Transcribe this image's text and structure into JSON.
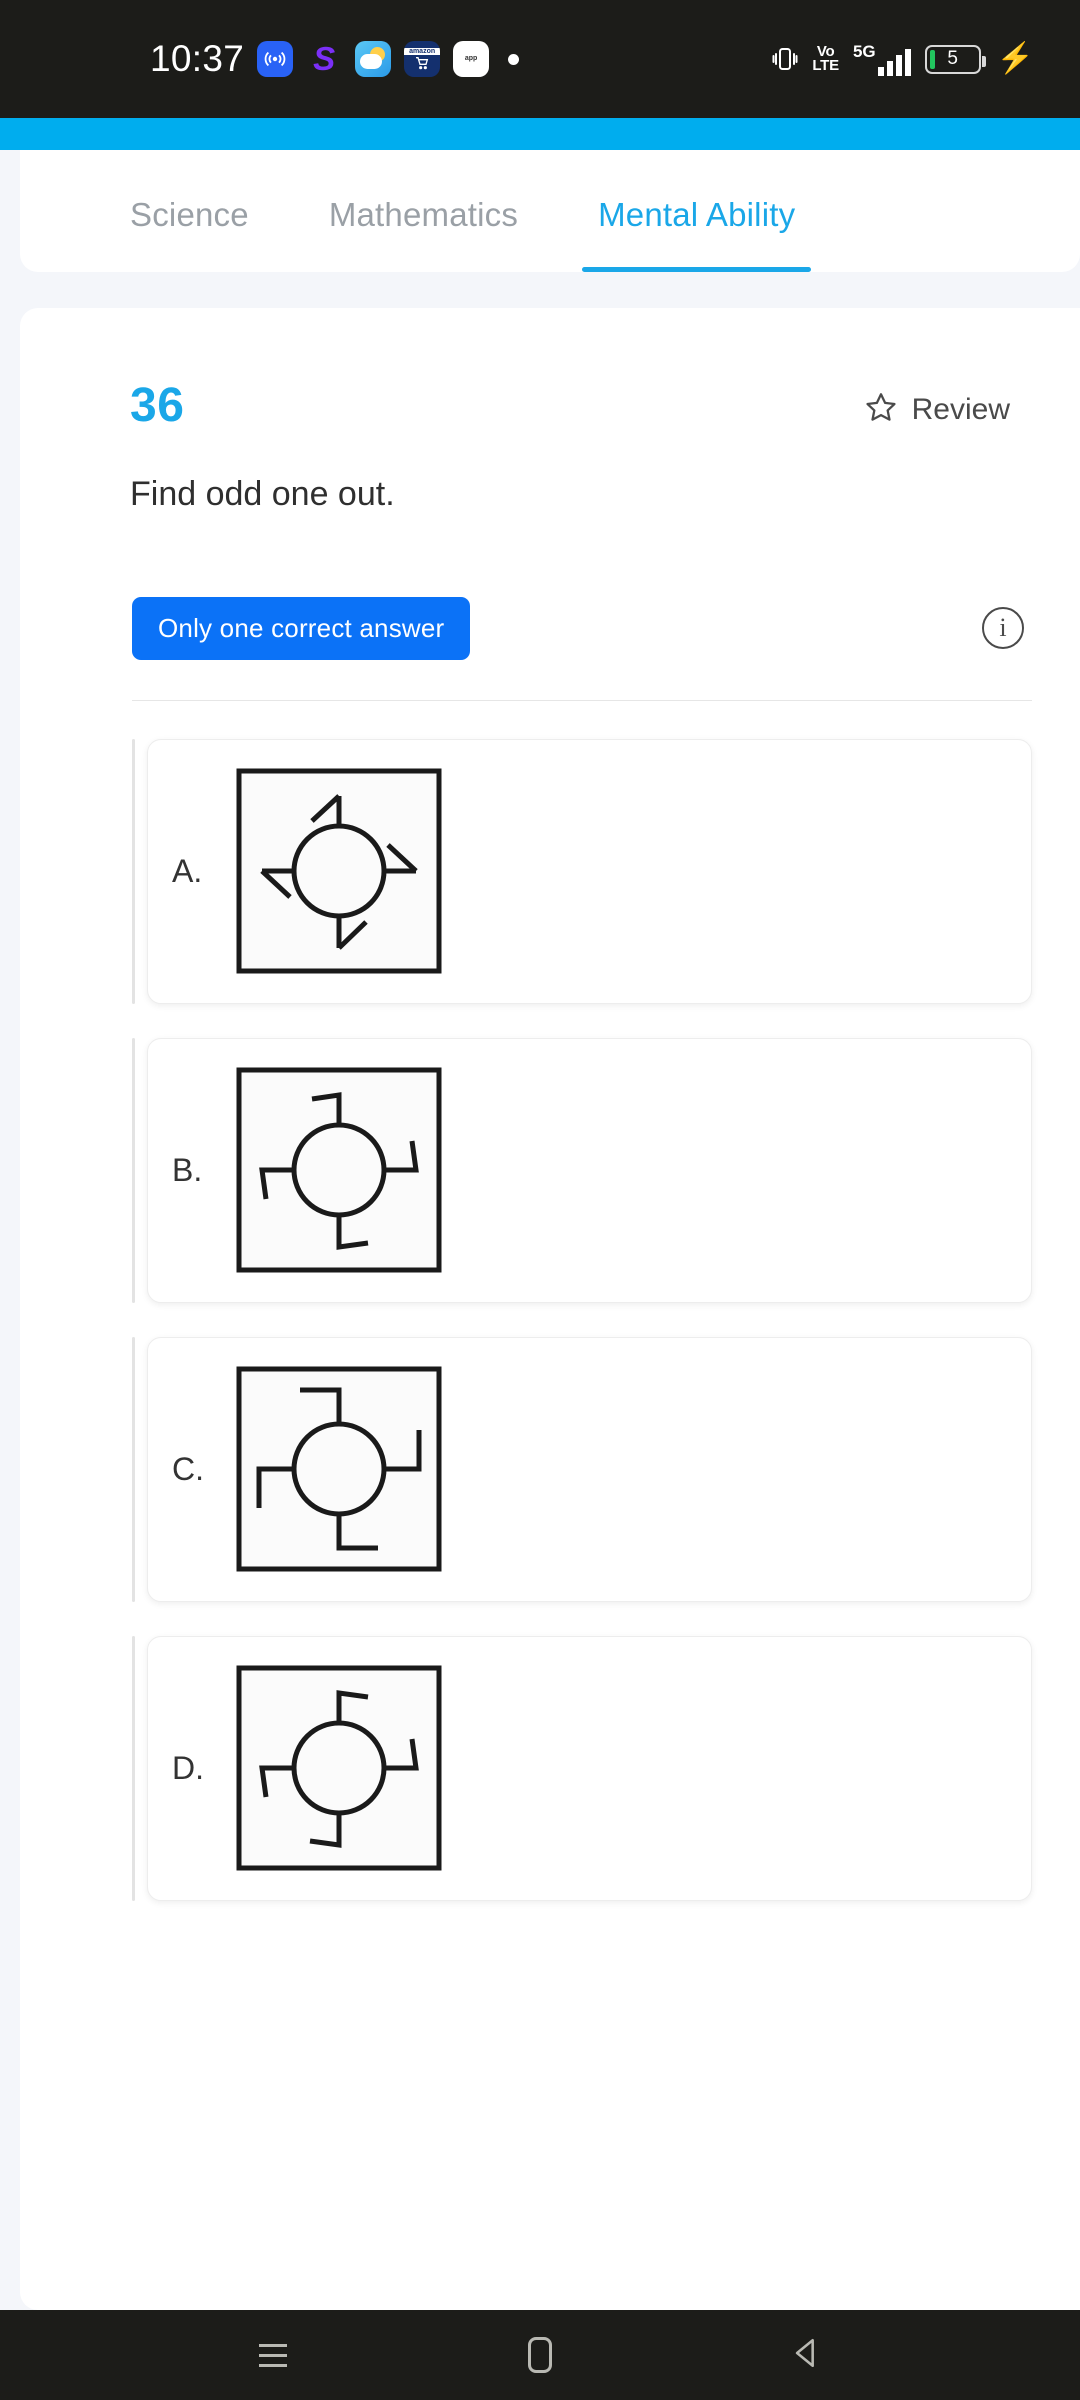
{
  "status_bar": {
    "clock": "10:37",
    "notification_icons": [
      "broadcast-icon",
      "s-app-icon",
      "weather-icon",
      "shopping-cart-icon",
      "white-app-icon",
      "overflow-dot-icon"
    ],
    "shopping_cart_label": "amazon",
    "white_app_label": "app",
    "vibrate_icon": "vibrate-icon",
    "volte_top": "Vo",
    "volte_bottom": "LTE",
    "network_type": "5G",
    "signal_bars": 4,
    "battery_percent": "5",
    "battery_charging": true,
    "colors": {
      "bar_background": "#1c1c19",
      "battery_fill": "#22c55e"
    }
  },
  "header": {
    "accent_color": "#00adee"
  },
  "tabs": [
    {
      "label": "Science",
      "active": false
    },
    {
      "label": "Mathematics",
      "active": false
    },
    {
      "label": "Mental Ability",
      "active": true
    }
  ],
  "question": {
    "number": "36",
    "number_color": "#1aa7e8",
    "review_label": "Review",
    "review_icon": "star-outline-icon",
    "text": "Find odd one out.",
    "badge_label": "Only one correct answer",
    "badge_color": "#0b72f7",
    "info_icon": "info-circle-icon",
    "info_glyph": "i"
  },
  "options": [
    {
      "letter": "A.",
      "figure_name": "figure-circle-with-diagonal-hooks",
      "figure_description": "Square frame containing a circle with four radial arms; each arm terminates in a diagonal barb angled away from the arm."
    },
    {
      "letter": "B.",
      "figure_name": "figure-circle-with-clockwise-right-angle-hooks",
      "figure_description": "Square frame containing a circle with four radial arms; each arm terminates in a right-angle hook turning clockwise."
    },
    {
      "letter": "C.",
      "figure_name": "figure-circle-with-long-right-angle-hooks",
      "figure_description": "Square frame containing a circle with four radial arms; each arm terminates in a long right-angle hook turning clockwise."
    },
    {
      "letter": "D.",
      "figure_name": "figure-circle-with-counterclockwise-right-angle-hooks",
      "figure_description": "Square frame containing a circle with four radial arms; each arm terminates in a right-angle hook turning counter-clockwise."
    }
  ],
  "nav_bar": {
    "recents_label": "recents-icon",
    "home_label": "home-icon",
    "back_label": "back-icon"
  }
}
